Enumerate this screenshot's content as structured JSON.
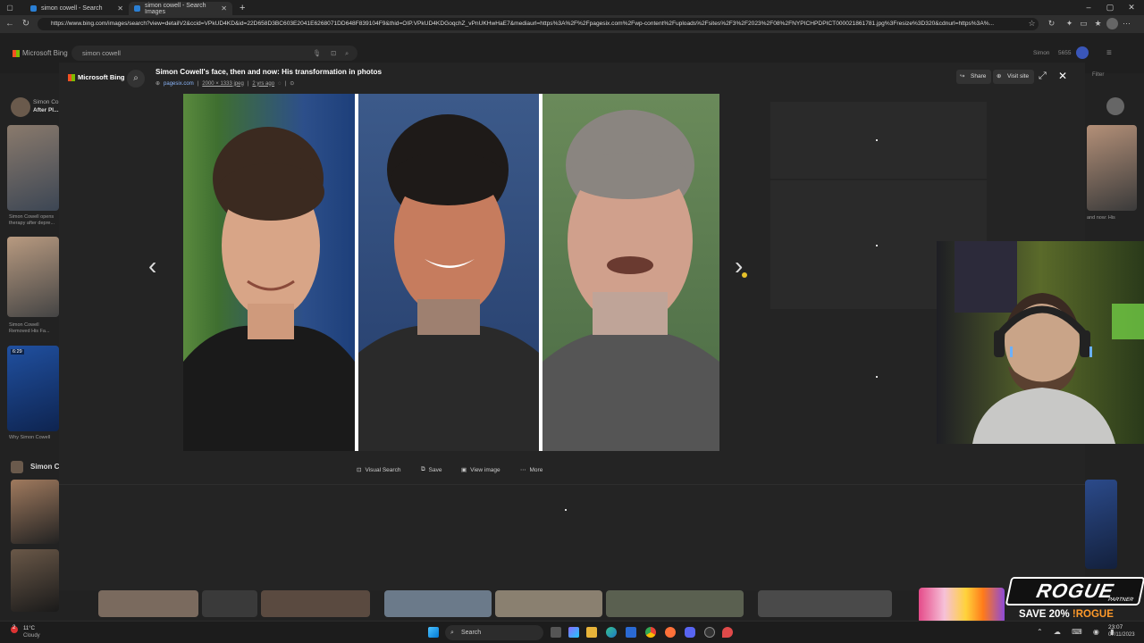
{
  "browser": {
    "tabs": [
      {
        "label": "simon cowell - Search",
        "active": false
      },
      {
        "label": "simon cowell - Search Images",
        "active": true
      }
    ],
    "new_tab": "+",
    "url": "https://www.bing.com/images/search?view=detailV2&ccid=VPkUD4KD&id=22D658D3BC603E2041E6268071DD648F839104F9&thid=OIP.VPkUD4KDGoqchZ_vPnUKHwHaE7&mediaurl=https%3A%2F%2Fpagesix.com%2Fwp-content%2Fuploads%2Fsites%2F3%2F2023%2F08%2FNYPICHPDPICT000021861781.jpg%3Fresize%3D320&cdnurl=https%3A%..."
  },
  "bing": {
    "logo_text": "Microsoft Bing",
    "search_query": "simon cowell",
    "user_name": "Simon",
    "reward_points": "5655"
  },
  "overlay": {
    "logo_text": "Microsoft Bing",
    "title": "Simon Cowell's face, then and now: His transformation in photos",
    "source_site": "pagesix.com",
    "dimensions": "2000 × 1333 jpeg",
    "age": "2 yrs ago",
    "separator": "|",
    "share_label": "Share",
    "visit_label": "Visit site",
    "actions": {
      "visual_search": "Visual Search",
      "save": "Save",
      "view_image": "View image",
      "more": "More"
    },
    "prev_glyph": "‹",
    "next_glyph": "›"
  },
  "background_results": {
    "left_labels": [
      "Simon Co...",
      "After Pl..."
    ],
    "captions": [
      "Simon Cowell opens therapy after depre...",
      "Simon Cowell Removed His Fa...",
      "Why Simon Cowell"
    ],
    "video_badge": "6:29",
    "related_heading": "Simon C",
    "right_caption": "and now: His",
    "filter_label": "Filter"
  },
  "webcam": {
    "label": ""
  },
  "ad": {
    "brand": "ROGUE",
    "sub": "PARTNER",
    "offer": "SAVE 20% ",
    "code": "!ROGUE"
  },
  "taskbar": {
    "weather_temp": "11°C",
    "weather_desc": "Cloudy",
    "search_label": "Search",
    "time": "23:07",
    "date": "07/11/2023",
    "notification_count": "2"
  },
  "colors": {
    "accent_blue": "#2a7fd4",
    "overlay_bg": "#242424",
    "ad_pink": "#e54b8a",
    "ad_orange": "#ff7a1a"
  }
}
